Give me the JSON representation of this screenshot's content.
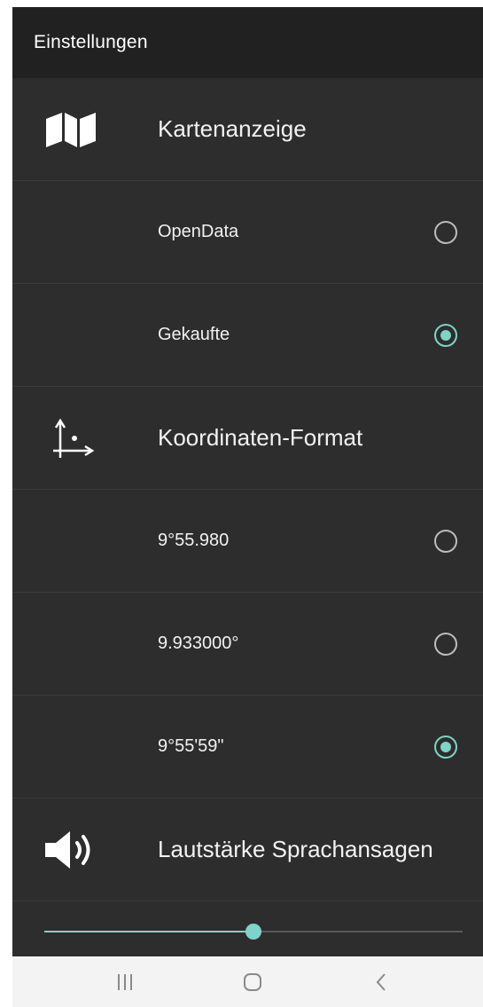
{
  "toolbar": {
    "title": "Einstellungen"
  },
  "sections": {
    "map_display": {
      "label": "Kartenanzeige",
      "icon": "map-icon",
      "options": [
        {
          "label": "OpenData",
          "selected": false
        },
        {
          "label": "Gekaufte",
          "selected": true
        }
      ]
    },
    "coordinate_format": {
      "label": "Koordinaten-Format",
      "icon": "axes-icon",
      "options": [
        {
          "label": "9°55.980",
          "selected": false
        },
        {
          "label": "9.933000°",
          "selected": false
        },
        {
          "label": "9°55'59\"",
          "selected": true
        }
      ]
    },
    "voice_volume": {
      "label": "Lautstärke Sprachansagen",
      "icon": "speaker-icon",
      "level_fraction": 0.5
    }
  },
  "navbar": {
    "buttons": [
      "recent-apps-icon",
      "home-icon",
      "back-icon"
    ]
  },
  "colors": {
    "accent": "#7fd3c8",
    "background": "#2d2d2d",
    "toolbar": "#212121",
    "navbar": "#f3f3f3"
  }
}
